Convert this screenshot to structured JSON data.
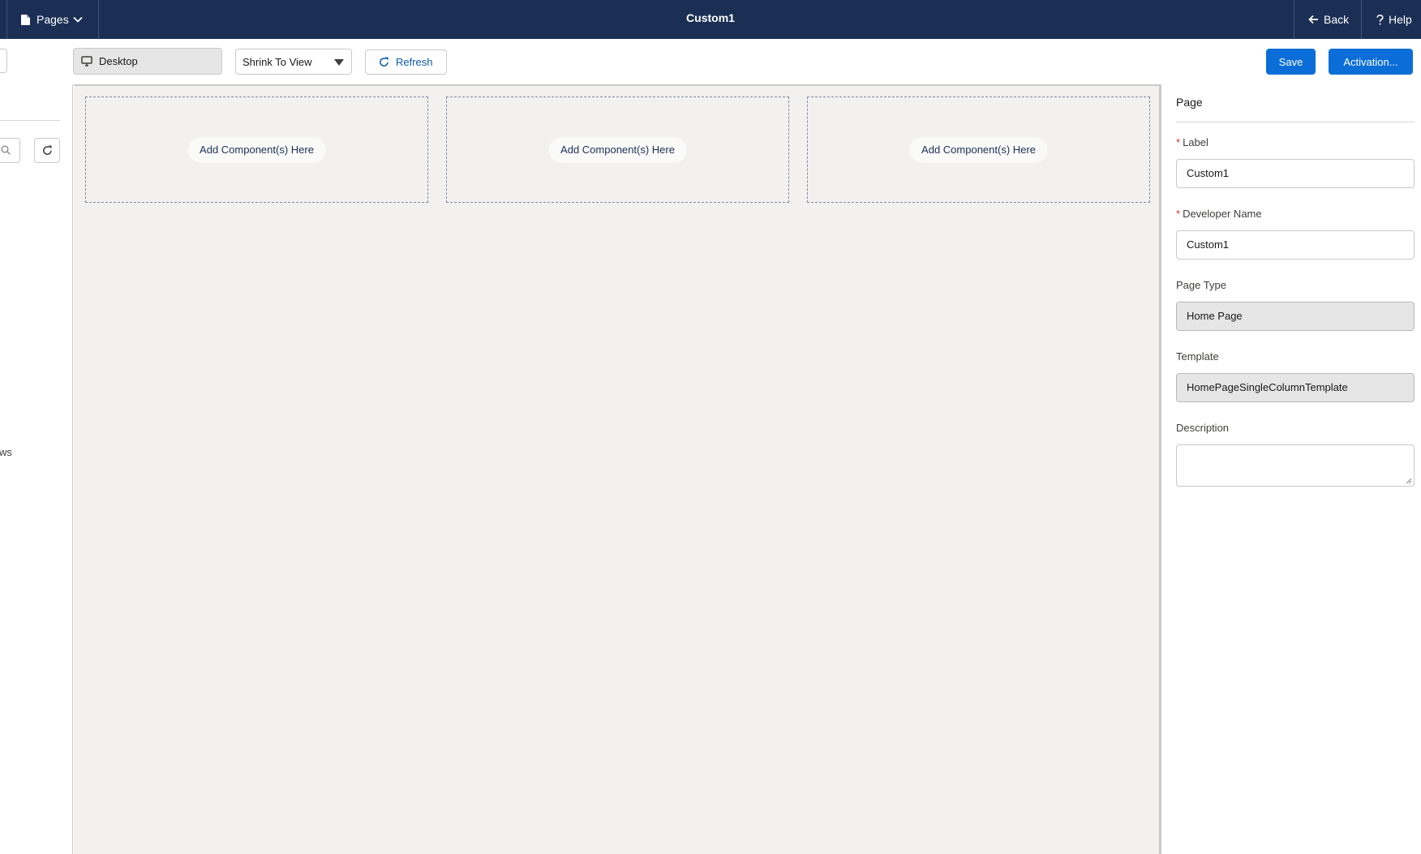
{
  "topbar": {
    "pages_label": "Pages",
    "title": "Custom1",
    "back_label": "Back",
    "help_label": "Help",
    "background_color": "#1b2f55"
  },
  "toolbar": {
    "device_label": "Desktop",
    "zoom_label": "Shrink To View",
    "refresh_label": "Refresh",
    "save_label": "Save",
    "activation_label": "Activation...",
    "primary_color": "#0b6ed8"
  },
  "left_panel": {
    "clipped_text": "ws"
  },
  "canvas": {
    "regions": [
      {
        "placeholder": "Add Component(s) Here"
      },
      {
        "placeholder": "Add Component(s) Here"
      },
      {
        "placeholder": "Add Component(s) Here"
      }
    ]
  },
  "properties": {
    "heading": "Page",
    "label_field": {
      "label": "Label",
      "required_marker": "*",
      "value": "Custom1"
    },
    "developer_name_field": {
      "label": "Developer Name",
      "required_marker": "*",
      "value": "Custom1"
    },
    "page_type_field": {
      "label": "Page Type",
      "value": "Home Page"
    },
    "template_field": {
      "label": "Template",
      "value": "HomePageSingleColumnTemplate"
    },
    "description_field": {
      "label": "Description",
      "value": ""
    }
  },
  "icons": {
    "pages": "document-icon",
    "pages_menu": "chevron-down-icon",
    "back": "arrow-left-icon",
    "help": "question-icon",
    "device": "monitor-icon",
    "zoom": "caret-down-icon",
    "refresh": "refresh-icon",
    "search": "search-icon"
  }
}
